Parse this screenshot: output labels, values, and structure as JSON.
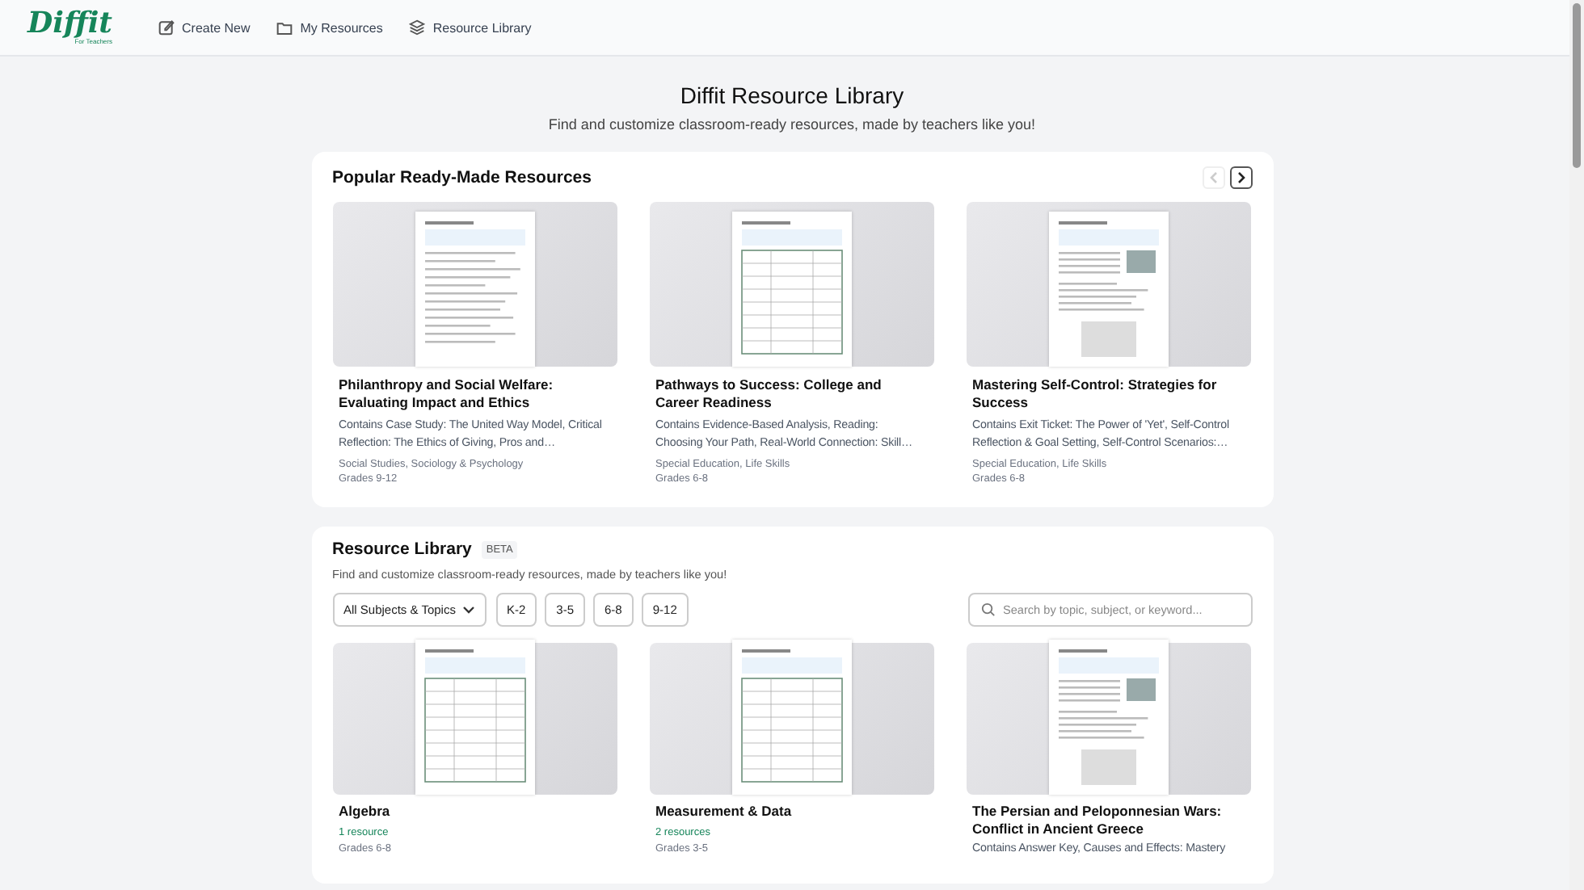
{
  "nav": {
    "logo": "Diffit",
    "logo_sub": "For Teachers",
    "items": [
      {
        "label": "Create New"
      },
      {
        "label": "My Resources"
      },
      {
        "label": "Resource Library"
      }
    ]
  },
  "hero": {
    "title": "Diffit Resource Library",
    "subtitle": "Find and customize classroom-ready resources, made by teachers like you!"
  },
  "popular": {
    "title": "Popular Ready-Made Resources",
    "prev_disabled": true,
    "next_disabled": false,
    "cards": [
      {
        "title": "Philanthropy and Social Welfare: Evaluating Impact and Ethics",
        "description": "Contains Case Study: The United Way Model, Critical Reflection: The Ethics of Giving, Pros and…",
        "subjects": "Social Studies, Sociology & Psychology",
        "grades": "Grades 9-12"
      },
      {
        "title": "Pathways to Success: College and Career Readiness",
        "description": "Contains Evidence-Based Analysis, Reading: Choosing Your Path, Real-World Connection: Skill…",
        "subjects": "Special Education, Life Skills",
        "grades": "Grades 6-8"
      },
      {
        "title": "Mastering Self-Control: Strategies for Success",
        "description": "Contains Exit Ticket: The Power of 'Yet', Self-Control Reflection & Goal Setting, Self-Control Scenarios:…",
        "subjects": "Special Education, Life Skills",
        "grades": "Grades 6-8"
      }
    ]
  },
  "library": {
    "title": "Resource Library",
    "badge": "BETA",
    "subtitle": "Find and customize classroom-ready resources, made by teachers like you!",
    "dropdown": "All Subjects & Topics",
    "grade_filters": [
      {
        "label": "K-2",
        "selected": false
      },
      {
        "label": "3-5",
        "selected": false
      },
      {
        "label": "6-8",
        "selected": false
      },
      {
        "label": "9-12",
        "selected": false
      }
    ],
    "search": {
      "placeholder": "Search by topic, subject, or keyword..."
    },
    "cards": [
      {
        "title": "Algebra",
        "count": "1 resource",
        "grades": "Grades 6-8"
      },
      {
        "title": "Measurement & Data",
        "count": "2 resources",
        "grades": "Grades 3-5"
      },
      {
        "title": "The Persian and Peloponnesian Wars: Conflict in Ancient Greece",
        "description": "Contains Answer Key, Causes and Effects: Mastery"
      }
    ]
  }
}
